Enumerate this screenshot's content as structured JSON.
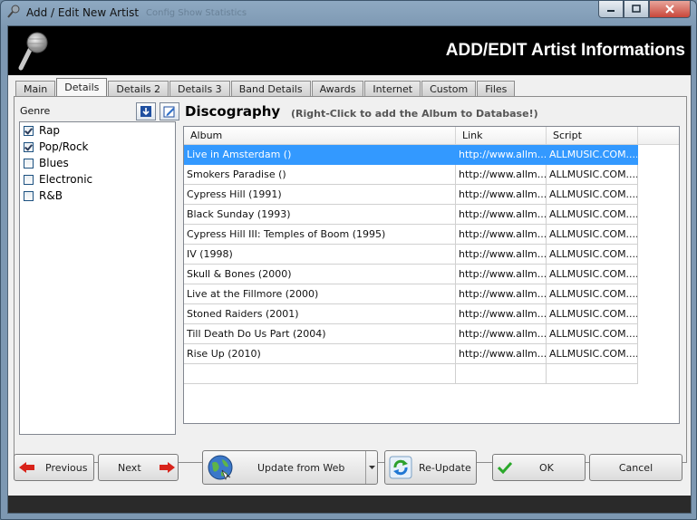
{
  "window": {
    "title": "Add / Edit New Artist",
    "ghost_text": "Config   Show Statistics"
  },
  "header": {
    "title": "ADD/EDIT Artist Informations"
  },
  "tabs": [
    {
      "label": "Main"
    },
    {
      "label": "Details",
      "active": true
    },
    {
      "label": "Details 2"
    },
    {
      "label": "Details 3"
    },
    {
      "label": "Band Details"
    },
    {
      "label": "Awards"
    },
    {
      "label": "Internet"
    },
    {
      "label": "Custom"
    },
    {
      "label": "Files"
    }
  ],
  "genre": {
    "label": "Genre",
    "items": [
      {
        "label": "Rap",
        "checked": true
      },
      {
        "label": "Pop/Rock",
        "checked": true
      },
      {
        "label": "Blues",
        "checked": false
      },
      {
        "label": "Electronic",
        "checked": false
      },
      {
        "label": "R&B",
        "checked": false
      }
    ]
  },
  "discography": {
    "title": "Discography",
    "hint": "(Right-Click to add the Album to Database!)",
    "columns": [
      "Album",
      "Link",
      "Script"
    ],
    "rows": [
      {
        "album": "Live in Amsterdam ()",
        "link": "http://www.allm...",
        "script": "ALLMUSIC.COM....",
        "selected": true
      },
      {
        "album": "Smokers Paradise ()",
        "link": "http://www.allm...",
        "script": "ALLMUSIC.COM...."
      },
      {
        "album": "Cypress Hill (1991)",
        "link": "http://www.allm...",
        "script": "ALLMUSIC.COM...."
      },
      {
        "album": "Black Sunday (1993)",
        "link": "http://www.allm...",
        "script": "ALLMUSIC.COM...."
      },
      {
        "album": "Cypress Hill III: Temples of Boom (1995)",
        "link": "http://www.allm...",
        "script": "ALLMUSIC.COM...."
      },
      {
        "album": "IV (1998)",
        "link": "http://www.allm...",
        "script": "ALLMUSIC.COM...."
      },
      {
        "album": "Skull & Bones (2000)",
        "link": "http://www.allm...",
        "script": "ALLMUSIC.COM...."
      },
      {
        "album": "Live at the Fillmore (2000)",
        "link": "http://www.allm...",
        "script": "ALLMUSIC.COM...."
      },
      {
        "album": "Stoned Raiders (2001)",
        "link": "http://www.allm...",
        "script": "ALLMUSIC.COM...."
      },
      {
        "album": "Till Death Do Us Part (2004)",
        "link": "http://www.allm...",
        "script": "ALLMUSIC.COM...."
      },
      {
        "album": "Rise Up (2010)",
        "link": "http://www.allm...",
        "script": "ALLMUSIC.COM...."
      },
      {
        "album": "",
        "link": "",
        "script": ""
      }
    ]
  },
  "footer": {
    "previous": "Previous",
    "next": "Next",
    "update_from_web": "Update from Web",
    "re_update": "Re-Update",
    "ok": "OK",
    "cancel": "Cancel"
  },
  "colors": {
    "selection": "#3399ff",
    "header_band": "#000000",
    "arrow_red": "#d8231a",
    "check_green": "#2aa82a"
  }
}
